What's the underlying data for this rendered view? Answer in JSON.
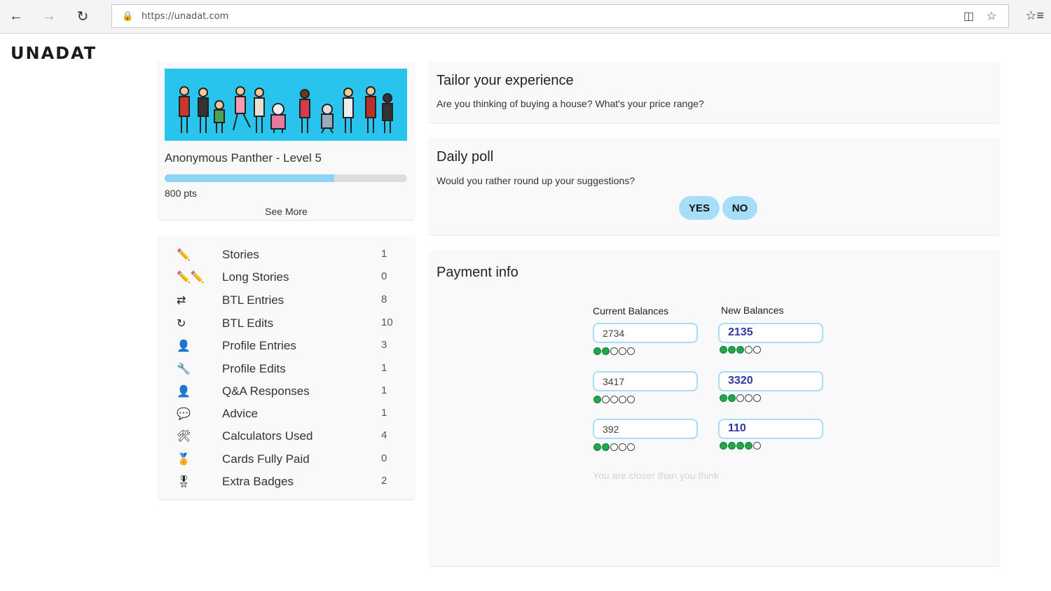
{
  "browser": {
    "url": "https://unadat.com"
  },
  "brand": {
    "logo": "UNADAT"
  },
  "profile": {
    "name": "Anonymous Panther - Level 5",
    "points": "800 pts",
    "progress_percent": 70,
    "see_more": "See More"
  },
  "stats": [
    {
      "icon": "pencil-icon",
      "label": "Stories",
      "count": "1"
    },
    {
      "icon": "two-pencils-icon",
      "label": "Long Stories",
      "count": "0"
    },
    {
      "icon": "arrows-icon",
      "label": "BTL Entries",
      "count": "8"
    },
    {
      "icon": "refresh-icon",
      "label": "BTL Edits",
      "count": "10"
    },
    {
      "icon": "person-icon",
      "label": "Profile Entries",
      "count": "3"
    },
    {
      "icon": "wrench-icon",
      "label": "Profile Edits",
      "count": "1"
    },
    {
      "icon": "qa-person-icon",
      "label": "Q&A Responses",
      "count": "1"
    },
    {
      "icon": "speech-bubble-icon",
      "label": "Advice",
      "count": "1"
    },
    {
      "icon": "tools-icon",
      "label": "Calculators Used",
      "count": "4"
    },
    {
      "icon": "gold-medal-icon",
      "label": "Cards Fully Paid",
      "count": "0"
    },
    {
      "icon": "silver-medal-icon",
      "label": "Extra Badges",
      "count": "2"
    }
  ],
  "tailor": {
    "title": "Tailor your experience",
    "question": "Are you thinking of buying a house? What's your price range?"
  },
  "poll": {
    "title": "Daily poll",
    "question": "Would you rather round up your suggestions?",
    "yes": "YES",
    "no": "NO"
  },
  "payment": {
    "title": "Payment info",
    "current_header": "Current Balances",
    "new_header": "New Balances",
    "rows": [
      {
        "current": "2734",
        "current_level": 2,
        "new": "2135",
        "new_level": 3
      },
      {
        "current": "3417",
        "current_level": 1,
        "new": "3320",
        "new_level": 2
      },
      {
        "current": "392",
        "current_level": 2,
        "new": "110",
        "new_level": 4
      }
    ],
    "hint": "You are closer than you think"
  }
}
